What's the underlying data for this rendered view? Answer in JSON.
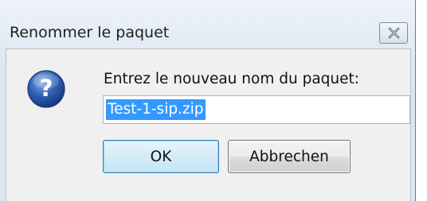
{
  "window": {
    "title": "Renommer le paquet",
    "close_icon": "close-x-icon"
  },
  "dialog": {
    "icon": "question-mark-icon",
    "prompt": "Entrez le nouveau nom du paquet:",
    "input_value": "Test-1-sip.zip",
    "input_selected": true
  },
  "buttons": {
    "ok_label": "OK",
    "cancel_label": "Abbrechen"
  },
  "colors": {
    "selection": "#3399ff",
    "icon_blue": "#2f5fb3"
  }
}
